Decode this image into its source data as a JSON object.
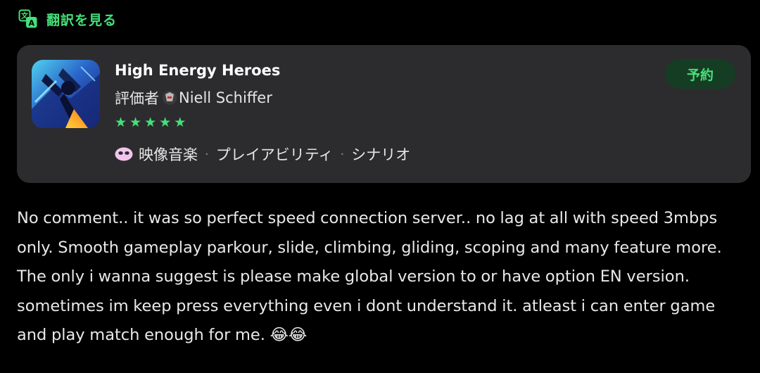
{
  "translate": {
    "label": "翻訳を見る",
    "icon": "translate-icon",
    "color": "#45e07a"
  },
  "review_card": {
    "game_title": "High Energy Heroes",
    "app_icon": "game-app-icon",
    "reviewer_prefix": "評価者",
    "reviewer_avatar": "reviewer-avatar-icon",
    "reviewer_name": "Niell Schiffer",
    "rating": 5,
    "rating_max": 5,
    "star_glyph": "★",
    "tag_icon": "reaction-icon",
    "tags": [
      "映像音楽",
      "プレイアビリティ",
      "シナリオ"
    ],
    "tag_separator": "·",
    "reserve_button_label": "予約",
    "card_color": "#2c2c2e",
    "accent_color": "#45e07a"
  },
  "review": {
    "body": "No comment.. it was so perfect speed connection server.. no lag at all with speed 3mbps only. Smooth gameplay parkour, slide, climbing, gliding, scoping and many feature more. The only i wanna suggest is please make global version to or have option EN version. sometimes im keep press everything even i dont understand it. atleast i can enter game and play match enough for me. 😂😂"
  }
}
